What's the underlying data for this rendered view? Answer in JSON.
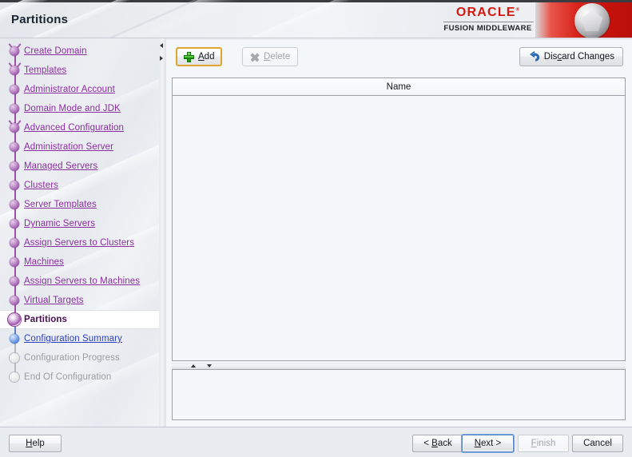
{
  "window": {
    "title": "Partitions"
  },
  "branding": {
    "wordmark": "ORACLE",
    "registered": "®",
    "subtitle": "FUSION MIDDLEWARE",
    "accent_red": "#d4180f",
    "badge_icon": "pentagon-logo-icon"
  },
  "sidebar": {
    "items": [
      {
        "label": "Create Domain",
        "state": "visited",
        "node": "purple",
        "branch": true
      },
      {
        "label": "Templates",
        "state": "visited",
        "node": "purple",
        "branch": true
      },
      {
        "label": "Administrator Account",
        "state": "visited",
        "node": "purple",
        "branch": false
      },
      {
        "label": "Domain Mode and JDK",
        "state": "visited",
        "node": "purple",
        "branch": false
      },
      {
        "label": "Advanced Configuration",
        "state": "visited",
        "node": "purple",
        "branch": true
      },
      {
        "label": "Administration Server",
        "state": "visited",
        "node": "purple",
        "branch": false
      },
      {
        "label": "Managed Servers",
        "state": "visited",
        "node": "purple",
        "branch": false
      },
      {
        "label": "Clusters",
        "state": "visited",
        "node": "purple",
        "branch": false
      },
      {
        "label": "Server Templates",
        "state": "visited",
        "node": "purple",
        "branch": false
      },
      {
        "label": "Dynamic Servers",
        "state": "visited",
        "node": "purple",
        "branch": false
      },
      {
        "label": "Assign Servers to Clusters",
        "state": "visited",
        "node": "purple",
        "branch": false
      },
      {
        "label": "Machines",
        "state": "visited",
        "node": "purple",
        "branch": false
      },
      {
        "label": "Assign Servers to Machines",
        "state": "visited",
        "node": "purple",
        "branch": false
      },
      {
        "label": "Virtual Targets",
        "state": "visited",
        "node": "purple",
        "branch": false
      },
      {
        "label": "Partitions",
        "state": "current",
        "node": "current",
        "branch": false
      },
      {
        "label": "Configuration Summary",
        "state": "next",
        "node": "blue",
        "branch": false
      },
      {
        "label": "Configuration Progress",
        "state": "disabled",
        "node": "grey",
        "branch": false
      },
      {
        "label": "End Of Configuration",
        "state": "disabled",
        "node": "grey",
        "branch": false
      }
    ],
    "link_color": "#8a2fa0",
    "next_color": "#2a3fc4",
    "disabled_color": "#9a9ca1"
  },
  "toolbar": {
    "add": {
      "label_pre": "",
      "label_mn": "A",
      "label_post": "dd",
      "icon": "plus-icon",
      "enabled": true,
      "focused": true
    },
    "delete": {
      "label_pre": "",
      "label_mn": "D",
      "label_post": "elete",
      "icon": "x-icon",
      "enabled": false
    },
    "discard": {
      "label_pre": "Dis",
      "label_mn": "c",
      "label_post": "ard Changes",
      "icon": "undo-arrow-icon",
      "enabled": true
    }
  },
  "table": {
    "columns": [
      "Name"
    ],
    "rows": [],
    "empty": true
  },
  "footer": {
    "help": {
      "label_pre": "",
      "label_mn": "H",
      "label_post": "elp",
      "enabled": true
    },
    "back": {
      "label_pre": "< ",
      "label_mn": "B",
      "label_post": "ack",
      "enabled": true
    },
    "next": {
      "label_pre": "",
      "label_mn": "N",
      "label_post": "ext >",
      "enabled": true,
      "default": true
    },
    "finish": {
      "label_pre": "",
      "label_mn": "F",
      "label_post": "inish",
      "enabled": false
    },
    "cancel": {
      "label_pre": "Cancel",
      "label_mn": "",
      "label_post": "",
      "enabled": true
    }
  }
}
